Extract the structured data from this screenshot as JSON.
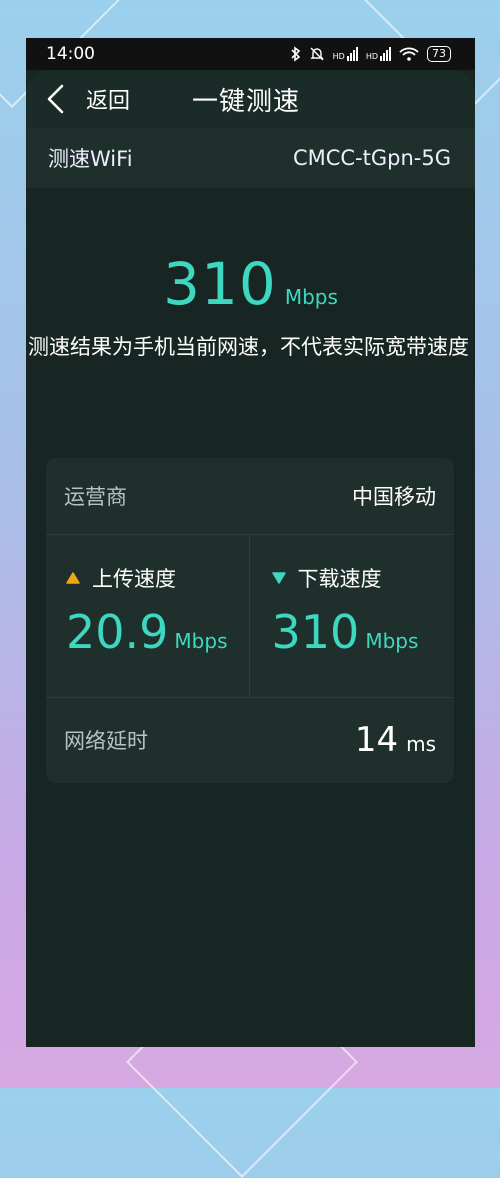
{
  "status_bar": {
    "time": "14:00",
    "icons": [
      "bluetooth-icon",
      "mute-icon",
      "hd-signal-icon",
      "hd-signal-icon",
      "wifi-icon"
    ],
    "hd1": "HD",
    "hd2": "HD",
    "battery": "73"
  },
  "header": {
    "back_label": "返回",
    "title": "一键测速"
  },
  "wifi": {
    "label": "测速WiFi",
    "ssid": "CMCC-tGpn-5G"
  },
  "result": {
    "value": "310",
    "unit": "Mbps",
    "note": "测速结果为手机当前网速，不代表实际宽带速度"
  },
  "card": {
    "carrier_label": "运营商",
    "carrier_value": "中国移动",
    "upload": {
      "label": "上传速度",
      "value": "20.9",
      "unit": "Mbps"
    },
    "download": {
      "label": "下载速度",
      "value": "310",
      "unit": "Mbps"
    },
    "latency": {
      "label": "网络延时",
      "value": "14",
      "unit": "ms"
    }
  },
  "colors": {
    "accent": "#3ed8c1",
    "upload_icon": "#f2a516",
    "download_icon": "#3ed8c1"
  }
}
